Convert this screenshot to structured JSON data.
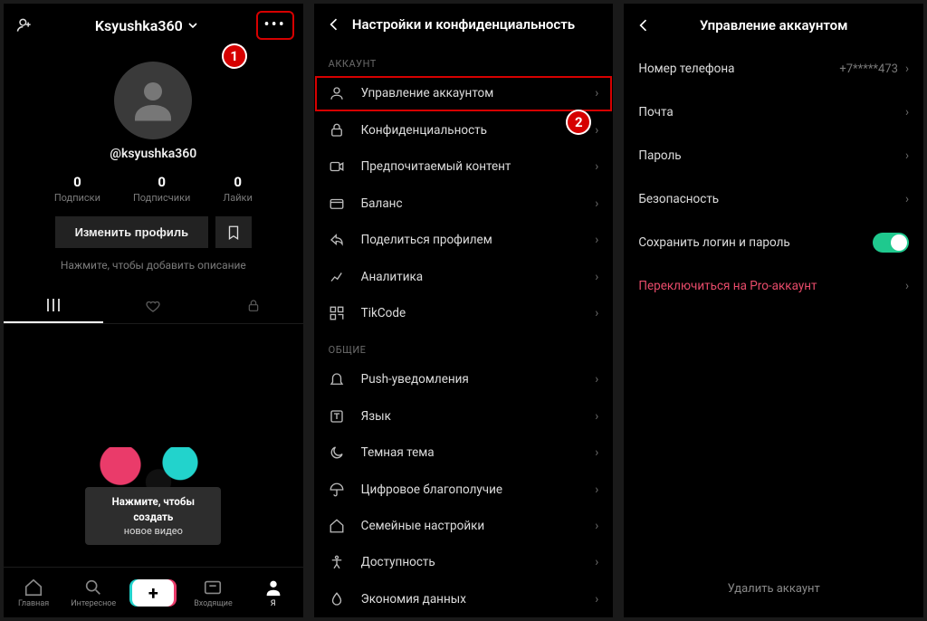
{
  "callouts": {
    "one": "1",
    "two": "2"
  },
  "profile": {
    "username": "Ksyushka360",
    "handle": "@ksyushka360",
    "stats": [
      {
        "n": "0",
        "l": "Подписки"
      },
      {
        "n": "0",
        "l": "Подписчики"
      },
      {
        "n": "0",
        "l": "Лайки"
      }
    ],
    "edit_btn": "Изменить профиль",
    "bio_prompt": "Нажмите, чтобы добавить описание",
    "tooltip_bold": "Нажмите, чтобы создать",
    "tooltip_sub": "новое видео",
    "tabbar": {
      "home": "Главная",
      "discover": "Интересное",
      "inbox": "Входящие",
      "me": "Я"
    }
  },
  "settings": {
    "title": "Настройки и конфиденциальность",
    "section_account": "АККАУНТ",
    "section_general": "ОБЩИЕ",
    "items_account": [
      "Управление аккаунтом",
      "Конфиденциальность",
      "Предпочитаемый контент",
      "Баланс",
      "Поделиться профилем",
      "Аналитика",
      "TikCode"
    ],
    "items_general": [
      "Push-уведомления",
      "Язык",
      "Темная тема",
      "Цифровое благополучие",
      "Семейные настройки",
      "Доступность",
      "Экономия данных"
    ]
  },
  "manage": {
    "title": "Управление аккаунтом",
    "phone_label": "Номер телефона",
    "phone_value": "+7*****473",
    "email_label": "Почта",
    "password_label": "Пароль",
    "security_label": "Безопасность",
    "save_login_label": "Сохранить логин и пароль",
    "switch_pro_label": "Переключиться на Pro-аккаунт",
    "delete_label": "Удалить аккаунт"
  }
}
